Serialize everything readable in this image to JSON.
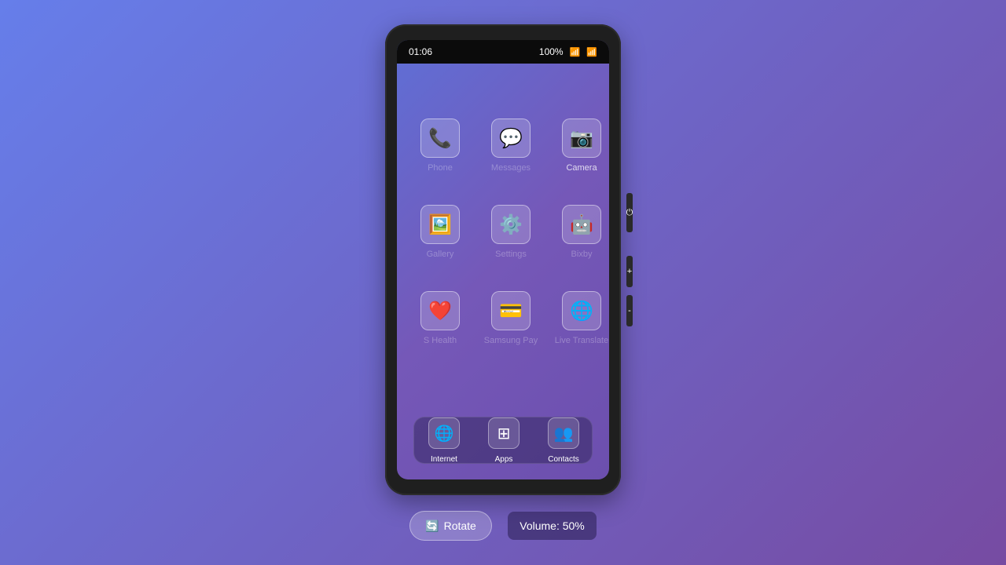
{
  "status": {
    "time": "01:06",
    "battery": "100%",
    "signal_icon": "📶",
    "wifi_icon": "📶"
  },
  "apps": [
    {
      "label": "Phone",
      "icon": "📞"
    },
    {
      "label": "Messages",
      "icon": "💬"
    },
    {
      "label": "Camera",
      "icon": "📷"
    },
    {
      "label": "Gallery",
      "icon": "🖼️"
    },
    {
      "label": "Settings",
      "icon": "⚙️"
    },
    {
      "label": "Bixby",
      "icon": "🤖"
    },
    {
      "label": "S Health",
      "icon": "❤️"
    },
    {
      "label": "Samsung Pay",
      "icon": "💳"
    },
    {
      "label": "Live Translate",
      "icon": "🌐"
    }
  ],
  "dock": [
    {
      "label": "Internet",
      "icon": "🌐"
    },
    {
      "label": "Apps",
      "icon": "⊞"
    },
    {
      "label": "Contacts",
      "icon": "👥"
    }
  ],
  "side": {
    "power": "⏻",
    "vol_up": "+",
    "vol_down": "-"
  },
  "controls": {
    "rotate_icon": "🔄",
    "rotate_label": "Rotate",
    "volume_text": "Volume: 50%"
  }
}
